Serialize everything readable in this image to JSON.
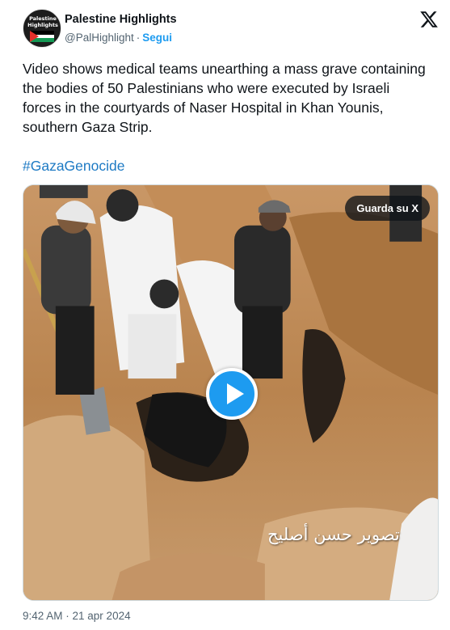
{
  "account": {
    "display_name": "Palestine Highlights",
    "handle": "@PalHighlight",
    "separator": "·",
    "follow_label": "Segui",
    "avatar_text": "Palestine Highlights"
  },
  "tweet": {
    "text": "Video shows medical teams unearthing a mass grave containing the bodies of 50 Palestinians who were executed by Israeli forces in the courtyards of Naser Hospital in Khan Younis, southern Gaza Strip.",
    "hashtag": "#GazaGenocide",
    "timestamp": "9:42 AM · 21 apr 2024"
  },
  "media": {
    "save_label": "Guarda su X",
    "video_caption": "تصوير حسن أصليح",
    "play_icon": "play-icon"
  },
  "icons": {
    "brand": "x-logo-icon",
    "flag": "palestine-flag-icon"
  },
  "colors": {
    "link": "#1d9bf0",
    "hashtag": "#1d7ac4",
    "secondary_text": "#536471",
    "text": "#0f1419"
  }
}
